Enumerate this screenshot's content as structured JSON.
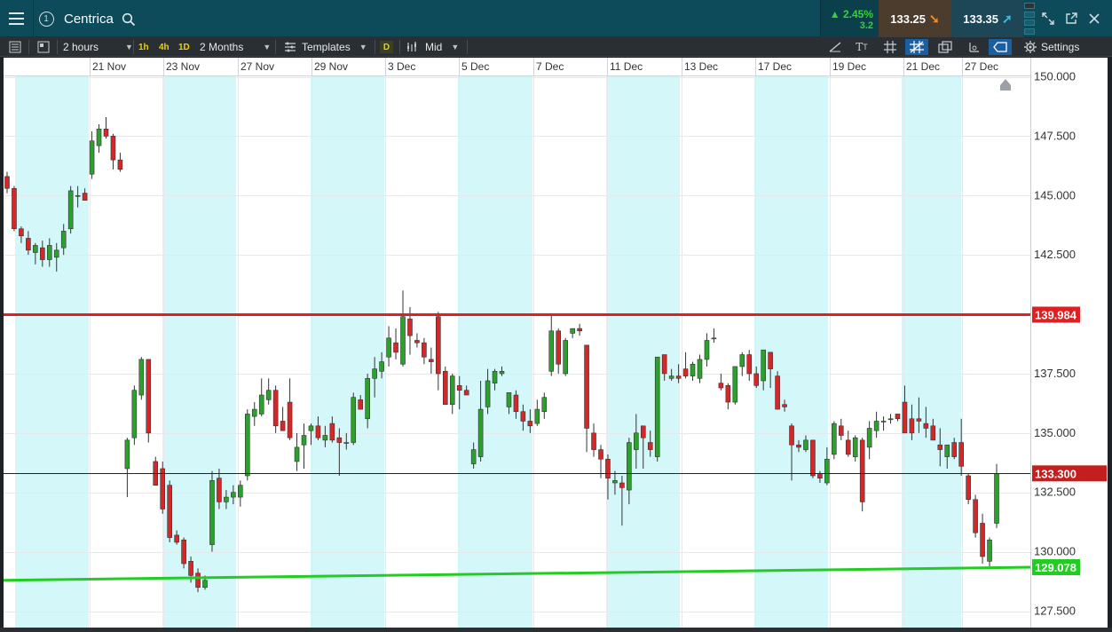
{
  "header": {
    "instrument_name": "Centrica",
    "workspace_number": "1",
    "change_percent": "▲ 2.45%",
    "change_absolute": "3.2",
    "sell_price": "133.25",
    "buy_price": "133.35"
  },
  "toolbar": {
    "interval_label": "2 hours",
    "quick_intervals": [
      "1h",
      "4h",
      "1D"
    ],
    "range_label": "2 Months",
    "templates_label": "Templates",
    "d_badge": "D",
    "price_type_label": "Mid",
    "settings_label": "Settings"
  },
  "icons": {
    "menu": "hamburger-menu-icon",
    "search": "search-icon",
    "expand": "expand-icon",
    "popout": "popout-icon",
    "close": "close-icon"
  },
  "colors": {
    "up": "#2ca02c",
    "down": "#d62728",
    "resistance_line": "#e02020",
    "support_line": "#22cc22",
    "current_price_tag": "#c41e1e",
    "weekend_shade": "#d4f7fa"
  },
  "chart_data": {
    "type": "candlestick",
    "x_tick_labels": [
      "21 Nov",
      "23 Nov",
      "27 Nov",
      "29 Nov",
      "3 Dec",
      "5 Dec",
      "7 Dec",
      "11 Dec",
      "13 Dec",
      "17 Dec",
      "19 Dec",
      "21 Dec",
      "27 Dec"
    ],
    "y_tick_labels": [
      "150.000",
      "147.500",
      "145.000",
      "142.500",
      "137.500",
      "135.000",
      "132.500",
      "130.000",
      "127.500"
    ],
    "y_ticks": [
      150,
      147.5,
      145,
      142.5,
      137.5,
      135,
      132.5,
      130,
      127.5
    ],
    "ylim": [
      127.0,
      150.2
    ],
    "current_price": 133.3,
    "current_price_label": "133.300",
    "resistance_level": 139.984,
    "resistance_label": "139.984",
    "support_label": "129.078",
    "support_line": {
      "start": 128.8,
      "end": 129.35
    },
    "candles": [
      [
        145.8,
        146.0,
        145.1,
        145.3
      ],
      [
        145.3,
        145.4,
        143.5,
        143.6
      ],
      [
        143.6,
        143.7,
        143.0,
        143.3
      ],
      [
        143.2,
        143.5,
        142.5,
        142.7
      ],
      [
        142.6,
        143.0,
        142.1,
        142.9
      ],
      [
        142.8,
        143.1,
        142.0,
        142.3
      ],
      [
        142.3,
        143.2,
        142.0,
        142.9
      ],
      [
        142.4,
        143.0,
        141.8,
        142.7
      ],
      [
        142.8,
        143.8,
        142.5,
        143.5
      ],
      [
        143.6,
        145.4,
        143.4,
        145.2
      ],
      [
        145.0,
        145.4,
        144.5,
        145.0
      ],
      [
        145.1,
        145.3,
        144.8,
        144.8
      ],
      [
        145.9,
        147.7,
        145.7,
        147.3
      ],
      [
        147.1,
        148.0,
        146.8,
        147.8
      ],
      [
        147.8,
        148.3,
        147.4,
        147.5
      ],
      [
        147.5,
        147.6,
        146.1,
        146.5
      ],
      [
        146.5,
        146.8,
        146.0,
        146.1
      ],
      [
        133.5,
        134.8,
        132.3,
        134.7
      ],
      [
        134.8,
        137.0,
        134.5,
        136.8
      ],
      [
        136.6,
        138.2,
        136.4,
        138.1
      ],
      [
        138.1,
        138.1,
        134.6,
        135.0
      ],
      [
        133.8,
        134.0,
        132.8,
        132.8
      ],
      [
        133.5,
        133.8,
        131.6,
        131.8
      ],
      [
        132.8,
        133.0,
        130.4,
        130.6
      ],
      [
        130.7,
        130.9,
        130.3,
        130.4
      ],
      [
        130.5,
        130.6,
        129.3,
        129.5
      ],
      [
        129.6,
        129.8,
        128.7,
        129.0
      ],
      [
        129.1,
        129.3,
        128.3,
        128.5
      ],
      [
        128.5,
        129.0,
        128.4,
        128.8
      ],
      [
        130.3,
        133.4,
        130.0,
        133.0
      ],
      [
        133.1,
        133.5,
        131.8,
        132.1
      ],
      [
        132.1,
        132.6,
        131.8,
        132.3
      ],
      [
        132.3,
        132.8,
        132.0,
        132.5
      ],
      [
        132.3,
        133.0,
        131.9,
        132.8
      ],
      [
        133.2,
        136.0,
        133.0,
        135.8
      ],
      [
        135.7,
        136.3,
        135.3,
        136.0
      ],
      [
        135.8,
        137.3,
        135.7,
        136.6
      ],
      [
        136.4,
        137.3,
        136.2,
        136.8
      ],
      [
        136.8,
        137.0,
        135.0,
        135.3
      ],
      [
        135.5,
        136.1,
        135.1,
        135.1
      ],
      [
        136.3,
        137.3,
        134.7,
        134.8
      ],
      [
        133.8,
        135.0,
        133.4,
        134.4
      ],
      [
        134.5,
        135.4,
        133.5,
        134.9
      ],
      [
        135.1,
        135.4,
        134.5,
        135.3
      ],
      [
        135.3,
        135.7,
        134.7,
        134.8
      ],
      [
        134.7,
        135.3,
        134.4,
        134.9
      ],
      [
        135.4,
        135.7,
        134.6,
        134.7
      ],
      [
        134.8,
        135.2,
        133.2,
        134.6
      ],
      [
        134.6,
        135.0,
        134.3,
        134.6
      ],
      [
        134.6,
        136.7,
        134.5,
        136.5
      ],
      [
        136.4,
        136.6,
        136.0,
        136.0
      ],
      [
        135.6,
        137.5,
        135.2,
        137.3
      ],
      [
        137.3,
        138.2,
        136.5,
        137.7
      ],
      [
        137.6,
        138.4,
        137.3,
        138.0
      ],
      [
        138.2,
        139.5,
        137.8,
        139.0
      ],
      [
        138.8,
        139.4,
        138.1,
        138.4
      ],
      [
        137.9,
        141.0,
        137.8,
        139.9
      ],
      [
        139.8,
        140.3,
        138.3,
        139.1
      ],
      [
        138.9,
        139.2,
        138.6,
        138.8
      ],
      [
        138.8,
        139.0,
        137.9,
        138.2
      ],
      [
        138.1,
        138.6,
        137.5,
        138.0
      ],
      [
        139.9,
        140.1,
        136.8,
        137.5
      ],
      [
        137.6,
        137.8,
        136.3,
        136.2
      ],
      [
        136.2,
        137.5,
        135.8,
        137.4
      ],
      [
        137.0,
        137.4,
        136.0,
        136.8
      ],
      [
        136.8,
        137.0,
        136.6,
        136.6
      ],
      [
        133.7,
        134.6,
        133.5,
        134.3
      ],
      [
        134.0,
        137.2,
        133.8,
        136.0
      ],
      [
        136.1,
        137.7,
        135.8,
        137.2
      ],
      [
        137.1,
        137.7,
        136.8,
        137.6
      ],
      [
        137.5,
        137.8,
        137.4,
        137.6
      ],
      [
        136.1,
        136.6,
        135.8,
        136.7
      ],
      [
        136.6,
        136.8,
        135.6,
        135.9
      ],
      [
        135.9,
        136.2,
        135.1,
        135.5
      ],
      [
        135.5,
        136.0,
        135.0,
        135.3
      ],
      [
        135.4,
        136.4,
        135.3,
        136.0
      ],
      [
        135.9,
        136.7,
        135.6,
        136.5
      ],
      [
        137.6,
        140.0,
        137.4,
        139.3
      ],
      [
        139.3,
        139.4,
        137.5,
        137.9
      ],
      [
        137.5,
        139.0,
        137.4,
        138.9
      ],
      [
        139.2,
        139.4,
        139.0,
        139.4
      ],
      [
        139.4,
        139.6,
        139.1,
        139.3
      ],
      [
        138.7,
        138.7,
        134.2,
        135.2
      ],
      [
        135.0,
        135.4,
        134.0,
        134.3
      ],
      [
        134.3,
        134.5,
        133.1,
        133.9
      ],
      [
        133.9,
        134.1,
        132.2,
        133.1
      ],
      [
        132.9,
        133.4,
        132.4,
        133.0
      ],
      [
        132.9,
        133.2,
        131.1,
        132.7
      ],
      [
        132.6,
        134.8,
        132.0,
        134.6
      ],
      [
        134.3,
        135.8,
        133.5,
        135.0
      ],
      [
        135.3,
        135.3,
        133.5,
        134.8
      ],
      [
        134.6,
        135.1,
        134.0,
        134.3
      ],
      [
        134.0,
        138.0,
        133.8,
        138.2
      ],
      [
        138.3,
        138.3,
        137.2,
        137.5
      ],
      [
        137.3,
        137.7,
        137.2,
        137.4
      ],
      [
        137.4,
        137.9,
        137.1,
        137.3
      ],
      [
        137.7,
        138.4,
        137.3,
        137.4
      ],
      [
        137.4,
        138.0,
        137.2,
        137.9
      ],
      [
        137.3,
        138.3,
        137.1,
        138.1
      ],
      [
        138.1,
        139.2,
        137.8,
        138.9
      ],
      [
        139.0,
        139.4,
        138.8,
        139.0
      ],
      [
        137.1,
        137.5,
        136.8,
        136.9
      ],
      [
        137.0,
        137.1,
        136.0,
        136.3
      ],
      [
        136.3,
        137.6,
        136.2,
        137.8
      ],
      [
        137.8,
        138.4,
        137.4,
        138.3
      ],
      [
        138.3,
        138.5,
        137.2,
        137.5
      ],
      [
        137.5,
        137.8,
        136.9,
        137.0
      ],
      [
        137.2,
        138.5,
        136.8,
        138.5
      ],
      [
        138.4,
        138.4,
        136.9,
        137.7
      ],
      [
        137.4,
        137.6,
        136.8,
        136.0
      ],
      [
        136.2,
        136.4,
        135.9,
        136.1
      ],
      [
        135.3,
        135.4,
        133.0,
        134.5
      ],
      [
        134.5,
        134.7,
        134.2,
        134.4
      ],
      [
        134.3,
        134.9,
        134.2,
        134.7
      ],
      [
        134.7,
        134.7,
        133.1,
        133.2
      ],
      [
        133.3,
        133.4,
        132.9,
        133.1
      ],
      [
        132.9,
        134.4,
        132.8,
        133.9
      ],
      [
        134.1,
        135.5,
        133.9,
        135.4
      ],
      [
        135.3,
        135.6,
        134.7,
        134.9
      ],
      [
        134.7,
        135.1,
        134.0,
        134.1
      ],
      [
        134.0,
        134.9,
        133.8,
        134.8
      ],
      [
        134.7,
        134.8,
        131.7,
        132.1
      ],
      [
        134.4,
        135.5,
        133.9,
        135.2
      ],
      [
        135.1,
        135.9,
        134.8,
        135.5
      ],
      [
        135.5,
        135.7,
        135.1,
        135.5
      ],
      [
        135.6,
        135.8,
        135.4,
        135.6
      ],
      [
        135.8,
        135.8,
        135.5,
        135.6
      ],
      [
        136.3,
        137.0,
        135.7,
        135.0
      ],
      [
        135.6,
        136.2,
        134.7,
        135.0
      ],
      [
        135.6,
        136.5,
        135.0,
        135.5
      ],
      [
        135.4,
        136.1,
        134.8,
        135.2
      ],
      [
        135.3,
        135.6,
        134.7,
        134.7
      ],
      [
        134.5,
        135.2,
        133.6,
        134.3
      ],
      [
        134.0,
        134.5,
        133.5,
        134.5
      ],
      [
        134.6,
        134.8,
        133.9,
        134.0
      ],
      [
        134.6,
        135.6,
        133.2,
        133.6
      ],
      [
        133.2,
        133.3,
        132.0,
        132.2
      ],
      [
        132.2,
        132.4,
        130.6,
        130.8
      ],
      [
        131.2,
        131.6,
        129.5,
        129.8
      ],
      [
        129.6,
        130.6,
        129.3,
        130.5
      ],
      [
        131.2,
        133.7,
        131.0,
        133.3
      ]
    ]
  }
}
